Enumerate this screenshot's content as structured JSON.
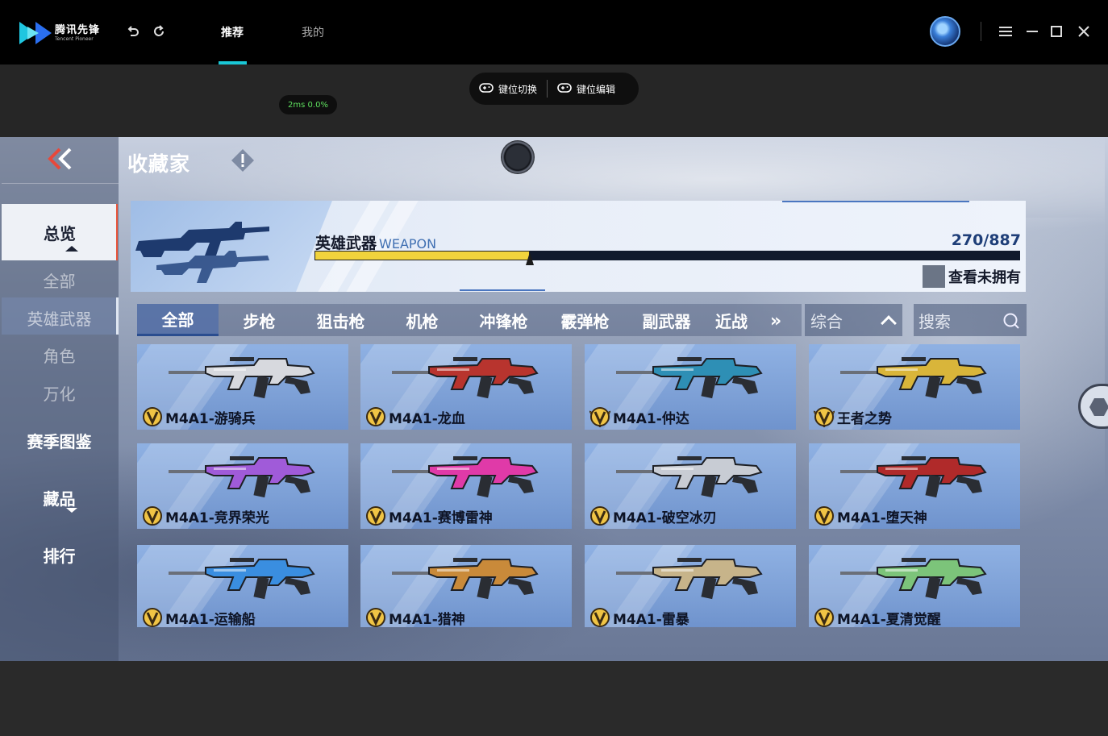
{
  "app": {
    "logo_cn": "腾讯先锋",
    "logo_en": "Tencent Pioneer",
    "tabs": [
      {
        "label": "推荐",
        "active": true
      },
      {
        "label": "我的",
        "active": false
      }
    ],
    "accent_color": "#19c7d6"
  },
  "toolbar": {
    "key_switch_label": "键位切换",
    "key_edit_label": "键位编辑",
    "latency": "2ms",
    "loss": "0.0%"
  },
  "game": {
    "title": "收藏家",
    "nav": {
      "overview": "总览",
      "all": "全部",
      "hero_weapons": "英雄武器",
      "characters": "角色",
      "misc": "万化",
      "season_atlas": "赛季图鉴",
      "collection": "藏品",
      "ranking": "排行"
    },
    "banner": {
      "title_cn": "英雄武器",
      "title_en": "WEAPON",
      "owned": "270",
      "total": "887",
      "progress_fraction": 0.305,
      "unowned_label": "查看未拥有"
    },
    "categories": [
      "全部",
      "步枪",
      "狙击枪",
      "机枪",
      "冲锋枪",
      "霰弹枪",
      "副武器",
      "近战"
    ],
    "more_glyph": "»",
    "sort_label": "综合",
    "search_placeholder": "搜索",
    "weapons": [
      {
        "name": "M4A1-游骑兵",
        "rank": "v",
        "accent": "#d7d9de"
      },
      {
        "name": "M4A1-龙血",
        "rank": "v",
        "accent": "#b8342e"
      },
      {
        "name": "M4A1-仲达",
        "rank": "v-wing",
        "accent": "#2e8fb5"
      },
      {
        "name": "王者之势",
        "rank": "v-wing",
        "accent": "#d9b53a"
      },
      {
        "name": "M4A1-竞界荣光",
        "rank": "v",
        "accent": "#a05bd9"
      },
      {
        "name": "M4A1-赛博雷神",
        "rank": "v",
        "accent": "#e03aa8"
      },
      {
        "name": "M4A1-破空冰刃",
        "rank": "v",
        "accent": "#c8ccd4"
      },
      {
        "name": "M4A1-堕天神",
        "rank": "v",
        "accent": "#b02a2a"
      },
      {
        "name": "M4A1-运输船",
        "rank": "v",
        "accent": "#3a8ee0"
      },
      {
        "name": "M4A1-猎神",
        "rank": "v",
        "accent": "#c98a3a"
      },
      {
        "name": "M4A1-雷暴",
        "rank": "v",
        "accent": "#c7b48a"
      },
      {
        "name": "M4A1-夏清觉醒",
        "rank": "v",
        "accent": "#7cc47a"
      }
    ]
  }
}
